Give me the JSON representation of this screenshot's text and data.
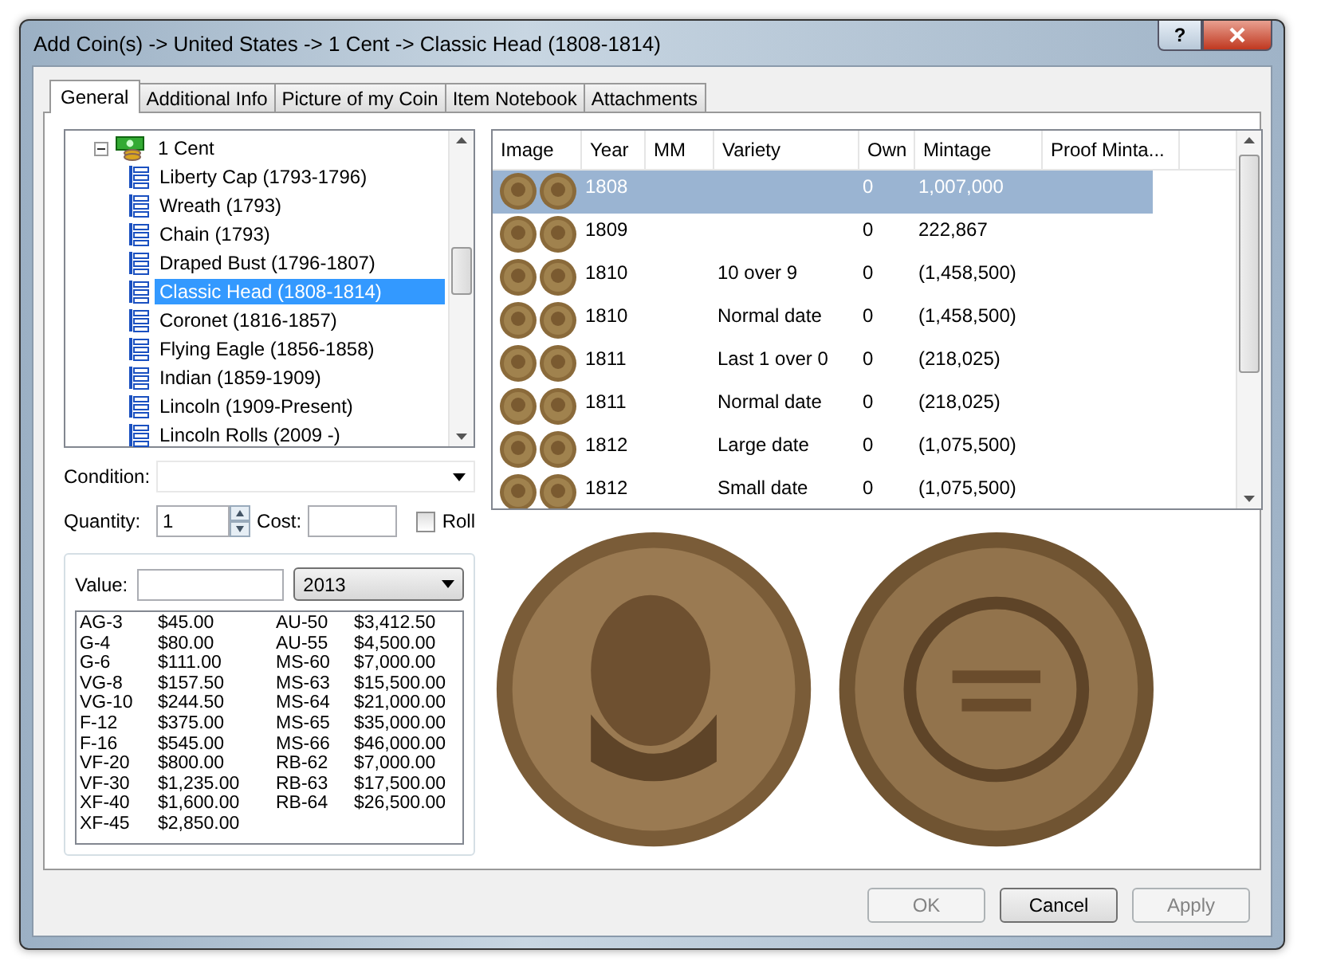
{
  "window": {
    "title": "Add Coin(s) -> United States -> 1 Cent -> Classic Head (1808-1814)",
    "help": "?"
  },
  "tabs": [
    {
      "label": "General",
      "selected": true
    },
    {
      "label": "Additional Info",
      "selected": false
    },
    {
      "label": "Picture of my Coin",
      "selected": false
    },
    {
      "label": "Item Notebook",
      "selected": false
    },
    {
      "label": "Attachments",
      "selected": false
    }
  ],
  "tree": {
    "label": "1 Cent",
    "expanded": true,
    "children": [
      {
        "label": "Liberty Cap (1793-1796)",
        "selected": false
      },
      {
        "label": "Wreath (1793)",
        "selected": false
      },
      {
        "label": "Chain (1793)",
        "selected": false
      },
      {
        "label": "Draped Bust (1796-1807)",
        "selected": false
      },
      {
        "label": "Classic Head (1808-1814)",
        "selected": true
      },
      {
        "label": "Coronet (1816-1857)",
        "selected": false
      },
      {
        "label": "Flying Eagle (1856-1858)",
        "selected": false
      },
      {
        "label": "Indian (1859-1909)",
        "selected": false
      },
      {
        "label": "Lincoln (1909-Present)",
        "selected": false
      },
      {
        "label": "Lincoln Rolls (2009 -)",
        "selected": false
      }
    ]
  },
  "table": {
    "columns": [
      "Image",
      "Year",
      "MM",
      "Variety",
      "Own",
      "Mintage",
      "Proof Minta..."
    ],
    "rows": [
      {
        "year": "1808",
        "variety": "",
        "own": "0",
        "mintage": "1,007,000",
        "selected": true
      },
      {
        "year": "1809",
        "variety": "",
        "own": "0",
        "mintage": "222,867",
        "selected": false
      },
      {
        "year": "1810",
        "variety": "10 over 9",
        "own": "0",
        "mintage": "(1,458,500)",
        "selected": false
      },
      {
        "year": "1810",
        "variety": "Normal date",
        "own": "0",
        "mintage": "(1,458,500)",
        "selected": false
      },
      {
        "year": "1811",
        "variety": "Last 1 over 0",
        "own": "0",
        "mintage": "(218,025)",
        "selected": false
      },
      {
        "year": "1811",
        "variety": "Normal date",
        "own": "0",
        "mintage": "(218,025)",
        "selected": false
      },
      {
        "year": "1812",
        "variety": "Large date",
        "own": "0",
        "mintage": "(1,075,500)",
        "selected": false
      },
      {
        "year": "1812",
        "variety": "Small date",
        "own": "0",
        "mintage": "(1,075,500)",
        "selected": false
      }
    ]
  },
  "condition": {
    "label": "Condition:"
  },
  "quantity": {
    "label": "Quantity:",
    "value": "1"
  },
  "cost": {
    "label": "Cost:"
  },
  "roll": {
    "label": "Roll",
    "checked": false
  },
  "values": {
    "label": "Value:",
    "year": "2013",
    "column_1": [
      {
        "grade": "AG-3",
        "price": "$45.00"
      },
      {
        "grade": "G-4",
        "price": "$80.00"
      },
      {
        "grade": "G-6",
        "price": "$111.00"
      },
      {
        "grade": "VG-8",
        "price": "$157.50"
      },
      {
        "grade": "VG-10",
        "price": "$244.50"
      },
      {
        "grade": "F-12",
        "price": "$375.00"
      },
      {
        "grade": "F-16",
        "price": "$545.00"
      },
      {
        "grade": "VF-20",
        "price": "$800.00"
      },
      {
        "grade": "VF-30",
        "price": "$1,235.00"
      },
      {
        "grade": "XF-40",
        "price": "$1,600.00"
      },
      {
        "grade": "XF-45",
        "price": "$2,850.00"
      }
    ],
    "column_2": [
      {
        "grade": "AU-50",
        "price": "$3,412.50"
      },
      {
        "grade": "AU-55",
        "price": "$4,500.00"
      },
      {
        "grade": "MS-60",
        "price": "$7,000.00"
      },
      {
        "grade": "MS-63",
        "price": "$15,500.00"
      },
      {
        "grade": "MS-64",
        "price": "$21,000.00"
      },
      {
        "grade": "MS-65",
        "price": "$35,000.00"
      },
      {
        "grade": "MS-66",
        "price": "$46,000.00"
      },
      {
        "grade": "RB-62",
        "price": "$7,000.00"
      },
      {
        "grade": "RB-63",
        "price": "$17,500.00"
      },
      {
        "grade": "RB-64",
        "price": "$26,500.00"
      }
    ]
  },
  "buttons": [
    {
      "label": "OK",
      "disabled": true
    },
    {
      "label": "Cancel",
      "disabled": false
    },
    {
      "label": "Apply",
      "disabled": true
    }
  ]
}
